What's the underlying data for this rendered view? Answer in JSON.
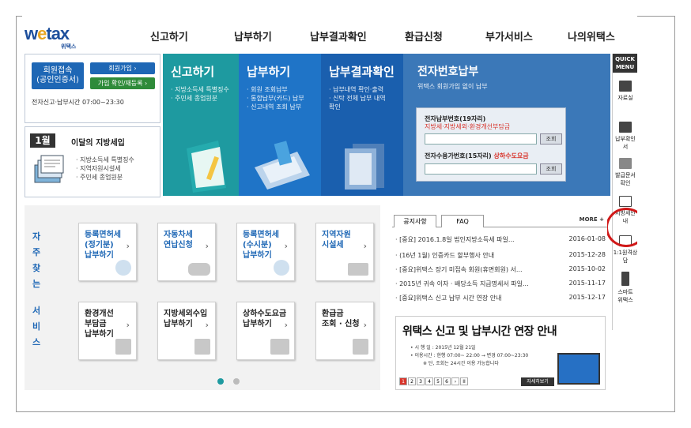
{
  "header": {
    "logo_text_a": "w",
    "logo_text_e": "e",
    "logo_text_b": "tax",
    "logo_sub": "위택스",
    "nav": [
      "신고하기",
      "납부하기",
      "납부결과확인",
      "환급신청",
      "부가서비스",
      "나의위택스"
    ]
  },
  "login": {
    "login_label": "회원접속\n(공인인증서)",
    "join_label": "회원가입 ›",
    "check_label": "가입 확인/재등록 ›",
    "hours": "전자신고·납부시간 07:00~23:30"
  },
  "monthly": {
    "badge": "1월",
    "title": "이달의 지방세입",
    "items": [
      "· 지방소득세 특별징수",
      "· 지역자원시설세",
      "· 주민세 종업원분"
    ]
  },
  "tiles": [
    {
      "title": "신고하기",
      "desc": "· 지방소득세 특별징수\n· 주민세 종업원분"
    },
    {
      "title": "납부하기",
      "desc": "· 회원 조회납부\n· 통합납부(카드) 납부\n· 신고내역 조회 납부"
    },
    {
      "title": "납부결과확인",
      "desc": "· 납부내역 확인·출력\n· 신탁 전체 납부 내역\n  확인"
    },
    {
      "title": "전자번호납부",
      "desc": "위택스 회원가입 없이 납부"
    }
  ],
  "e_pay": {
    "label1": "전자납부번호(19자리)",
    "label2": "지방세·지방세외·환경개선부담금",
    "btn": "조회",
    "label3": "전자수용가번호(15자리)",
    "label3_red": "상하수도요금"
  },
  "quick": {
    "head": "QUICK\nMENU",
    "items": [
      "자료실",
      "납부확인서",
      "발급문서확인",
      "지방세안내",
      "1:1원격상담",
      "스마트\n위택스"
    ]
  },
  "services": {
    "side": [
      "자",
      "주",
      "찾",
      "는",
      "서",
      "비",
      "스"
    ],
    "cards": [
      {
        "label": "등록면허세\n(정기분)\n납부하기",
        "blue": true
      },
      {
        "label": "자동차세\n연납신청",
        "blue": true
      },
      {
        "label": "등록면허세\n(수시분)\n납부하기",
        "blue": true
      },
      {
        "label": "지역자원\n시설세",
        "blue": true
      },
      {
        "label": "환경개선\n부담금\n납부하기",
        "blue": false
      },
      {
        "label": "지방세외수입\n납부하기",
        "blue": false
      },
      {
        "label": "상하수도요금\n납부하기",
        "blue": false
      },
      {
        "label": "환급금\n조회 · 신청",
        "blue": false
      }
    ]
  },
  "notice": {
    "tabs": [
      "공지사항",
      "FAQ"
    ],
    "more": "MORE +",
    "rows": [
      {
        "title": "· [중요] 2016.1.8일 법인지방소득세 파일...",
        "date": "2016-01-08"
      },
      {
        "title": "· (16년 1월) 인증카드 할부행사 안내",
        "date": "2015-12-28"
      },
      {
        "title": "· [중요]위택스 장기 미접속 회원(휴면회원) 서...",
        "date": "2015-10-02"
      },
      {
        "title": "· 2015년 귀속 이자 · 배당소득 지급명세서 파일...",
        "date": "2015-11-17"
      },
      {
        "title": "· [중요]위택스 신고 납부 시간 연장 안내",
        "date": "2015-12-17"
      }
    ],
    "banner_title": "위택스 신고 및 납부시간 연장 안내",
    "banner_l1": "• 시 행 일 : 2015년 12월 21일",
    "banner_l2": "• 이용시간 : 현행 07:00~ 22:00 → 변경 07:00~23:30",
    "banner_l3": "※ 단, 조회는 24시간 이용 가능합니다",
    "pages": [
      "1",
      "2",
      "3",
      "4",
      "5",
      "6",
      "›",
      "II"
    ],
    "more_btn": "자세히보기"
  }
}
